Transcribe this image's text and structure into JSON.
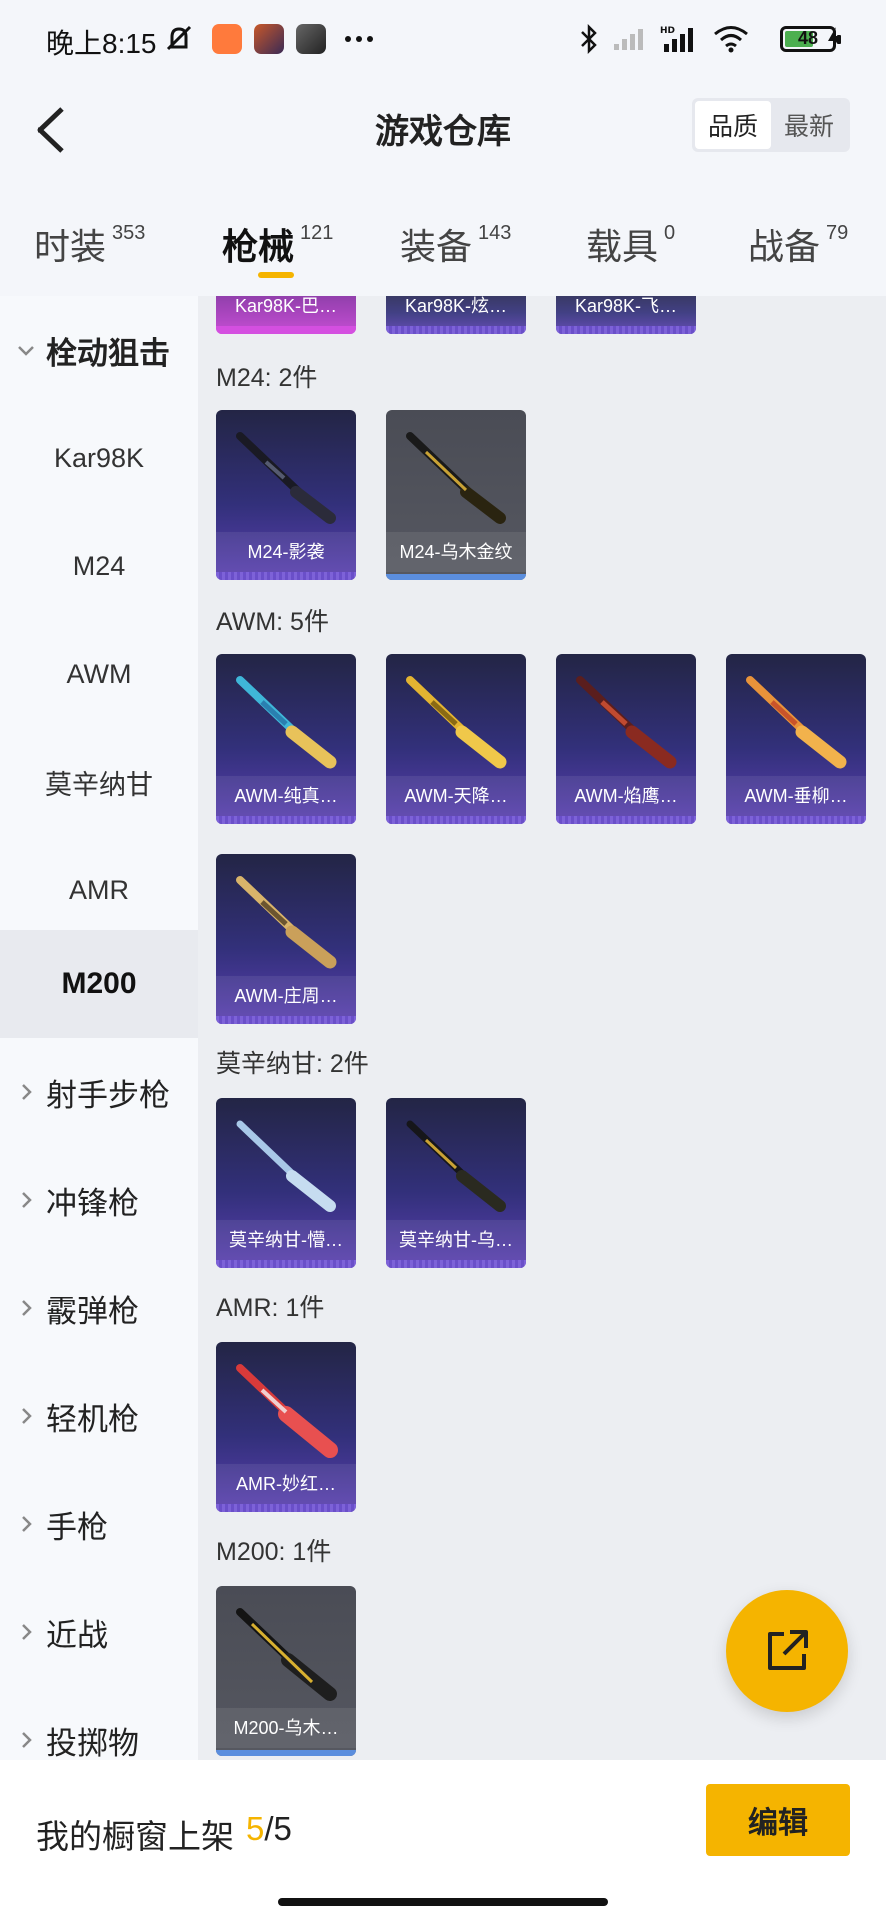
{
  "status_bar": {
    "time": "晚上8:15",
    "battery": "48"
  },
  "header": {
    "title": "游戏仓库",
    "toggle": [
      {
        "label": "品质",
        "active": true
      },
      {
        "label": "最新",
        "active": false
      }
    ]
  },
  "tabs": [
    {
      "label": "时装",
      "count": "353",
      "active": false
    },
    {
      "label": "枪械",
      "count": "121",
      "active": true
    },
    {
      "label": "装备",
      "count": "143",
      "active": false
    },
    {
      "label": "载具",
      "count": "0",
      "active": false
    },
    {
      "label": "战备",
      "count": "79",
      "active": false
    }
  ],
  "sidebar": {
    "expanded_category": "栓动狙击",
    "sub_items": [
      "Kar98K",
      "M24",
      "AWM",
      "莫辛纳甘",
      "AMR",
      "M200"
    ],
    "selected_sub": "M200",
    "categories": [
      "射手步枪",
      "冲锋枪",
      "霰弹枪",
      "轻机枪",
      "手枪",
      "近战",
      "投掷物"
    ]
  },
  "content": {
    "top_partial_cards": [
      "Kar98K-巴…",
      "Kar98K-炫…",
      "Kar98K-飞…"
    ],
    "groups": [
      {
        "label": "M24: 2件",
        "items": [
          "M24-影袭",
          "M24-乌木金纹"
        ]
      },
      {
        "label": "AWM: 5件",
        "items": [
          "AWM-纯真…",
          "AWM-天降…",
          "AWM-焰鹰…",
          "AWM-垂柳…",
          "AWM-庄周…"
        ]
      },
      {
        "label": "莫辛纳甘: 2件",
        "items": [
          "莫辛纳甘-懵…",
          "莫辛纳甘-乌…"
        ]
      },
      {
        "label": "AMR: 1件",
        "items": [
          "AMR-妙红…"
        ]
      },
      {
        "label": "M200: 1件",
        "items": [
          "M200-乌木…"
        ]
      }
    ]
  },
  "bottom_bar": {
    "label": "我的橱窗上架",
    "current": "5",
    "separator": "/",
    "max": "5",
    "edit_button": "编辑"
  },
  "colors": {
    "accent": "#f5b400",
    "card_purple": "#32307a",
    "card_gray": "#565861"
  }
}
